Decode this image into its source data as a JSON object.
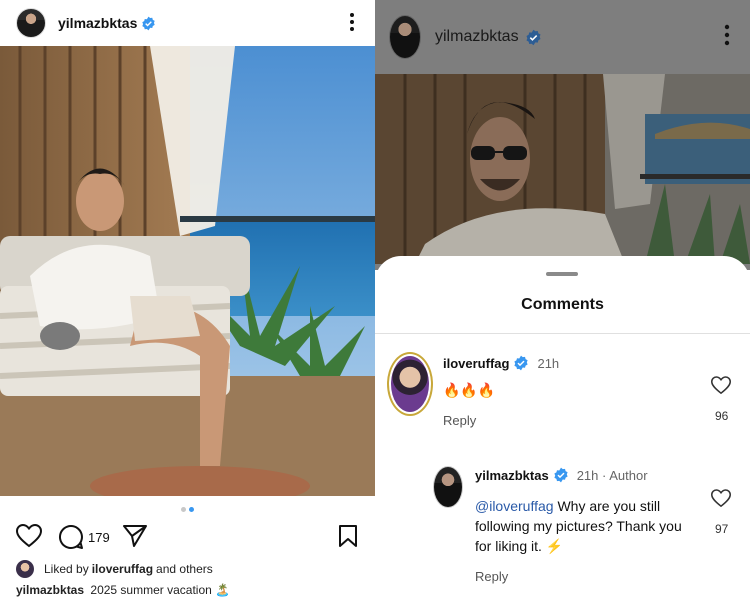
{
  "left_post": {
    "username": "yilmazbktas",
    "comment_count": "179",
    "liked_by_prefix": "Liked by",
    "liked_by_user": "iloveruffag",
    "liked_by_suffix": "and others",
    "caption_user": "yilmazbktas",
    "caption_text": "2025 summer vacation 🏝️",
    "carousel": {
      "count": 2,
      "active": 2
    }
  },
  "right_post": {
    "username": "yilmazbktas"
  },
  "comments_sheet": {
    "title": "Comments",
    "comments": [
      {
        "user": "iloveruffag",
        "time": "21h",
        "text": "🔥🔥🔥",
        "reply_label": "Reply",
        "likes": "96"
      },
      {
        "user": "yilmazbktas",
        "time": "21h · Author",
        "mention": "@iloveruffag",
        "text": "Why are you still following my pictures? Thank you for liking it. ⚡",
        "reply_label": "Reply",
        "likes": "97"
      }
    ]
  },
  "colors": {
    "verified_blue": "#3897f0",
    "mention_blue": "#2a5aa8",
    "carousel_active": "#3897f0"
  }
}
